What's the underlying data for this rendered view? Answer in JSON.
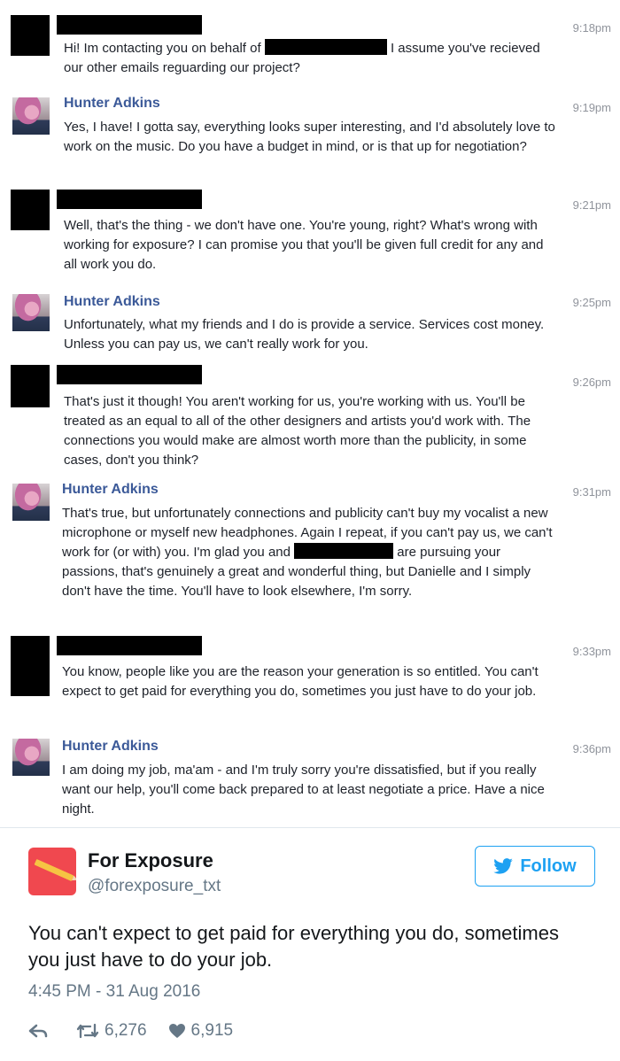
{
  "messages": [
    {
      "sender": "redacted",
      "time": "9:18pm",
      "parts": [
        "Hi! Im contacting you on behalf of ",
        "[R160]",
        " I assume you've recieved our other emails reguarding our project?"
      ]
    },
    {
      "sender": "Hunter Adkins",
      "time": "9:19pm",
      "parts": [
        "Yes, I have! I gotta say, everything looks super interesting, and I'd absolutely love to work on the music. Do you have a budget in mind, or is that up for negotiation?"
      ]
    },
    {
      "sender": "redacted",
      "time": "9:21pm",
      "parts": [
        "Well, that's the thing - we don't have one. You're young, right? What's wrong with working for exposure? I can promise you that you'll be given full credit for any and all work you do."
      ]
    },
    {
      "sender": "Hunter Adkins",
      "time": "9:25pm",
      "parts": [
        "Unfortunately, what my friends and I do is provide a service. Services cost money. Unless you can pay us, we can't really work for you."
      ]
    },
    {
      "sender": "redacted",
      "time": "9:26pm",
      "parts": [
        "That's just it though! You aren't working for us, you're working with us. You'll be treated as an equal to all of the other designers and artists you'd work with. The connections you would make are almost worth more than the publicity, in some cases, don't you think?"
      ]
    },
    {
      "sender": "Hunter Adkins",
      "time": "9:31pm",
      "parts": [
        "That's true, but unfortunately connections and publicity can't buy my vocalist a new microphone or myself new headphones. Again I repeat, if you can't pay us, we can't work for (or with) you. I'm glad you and ",
        "[R112]",
        " are pursuing your passions, that's genuinely a great and wonderful thing, but Danielle and I simply don't have the time. You'll have to look elsewhere, I'm sorry."
      ]
    },
    {
      "sender": "redacted",
      "time": "9:33pm",
      "parts": [
        "You know, people like you are the reason your generation is so entitled. You can't expect to get paid for everything you do, sometimes you just have to do your job."
      ]
    },
    {
      "sender": "Hunter Adkins",
      "time": "9:36pm",
      "parts": [
        "I am doing my job, ma'am - and I'm truly sorry you're dissatisfied, but if you really want our help, you'll come back prepared to at least negotiate a price. Have a nice night."
      ]
    }
  ],
  "tweet": {
    "name": "For Exposure",
    "handle": "@forexposure_txt",
    "follow_label": "Follow",
    "text": "You can't expect to get paid for everything you do, sometimes you just have to do your job.",
    "date": "4:45 PM - 31 Aug 2016",
    "retweets": "6,276",
    "likes": "6,915"
  },
  "colors": {
    "link": "#3b5998",
    "twitter_blue": "#1da1f2",
    "avatar_red": "#f0484f"
  }
}
